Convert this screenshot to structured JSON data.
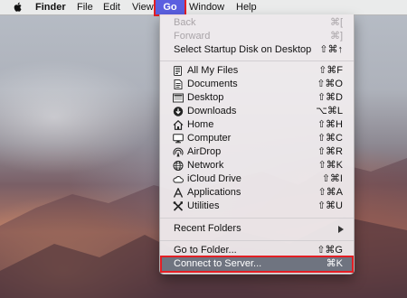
{
  "menubar": {
    "apple": "apple-icon",
    "items": [
      "Finder",
      "File",
      "Edit",
      "View",
      "Go",
      "Window",
      "Help"
    ]
  },
  "go_menu": {
    "top": [
      {
        "label": "Back",
        "shortcut": "⌘[",
        "enabled": false
      },
      {
        "label": "Forward",
        "shortcut": "⌘]",
        "enabled": false
      },
      {
        "label": "Select Startup Disk on Desktop",
        "shortcut": "⇧⌘↑",
        "enabled": true
      }
    ],
    "places": [
      {
        "label": "All My Files",
        "shortcut": "⇧⌘F",
        "icon": "all-my-files-icon"
      },
      {
        "label": "Documents",
        "shortcut": "⇧⌘O",
        "icon": "documents-icon"
      },
      {
        "label": "Desktop",
        "shortcut": "⇧⌘D",
        "icon": "desktop-icon"
      },
      {
        "label": "Downloads",
        "shortcut": "⌥⌘L",
        "icon": "downloads-icon"
      },
      {
        "label": "Home",
        "shortcut": "⇧⌘H",
        "icon": "home-icon"
      },
      {
        "label": "Computer",
        "shortcut": "⇧⌘C",
        "icon": "computer-icon"
      },
      {
        "label": "AirDrop",
        "shortcut": "⇧⌘R",
        "icon": "airdrop-icon"
      },
      {
        "label": "Network",
        "shortcut": "⇧⌘K",
        "icon": "network-icon"
      },
      {
        "label": "iCloud Drive",
        "shortcut": "⇧⌘I",
        "icon": "icloud-drive-icon"
      },
      {
        "label": "Applications",
        "shortcut": "⇧⌘A",
        "icon": "applications-icon"
      },
      {
        "label": "Utilities",
        "shortcut": "⇧⌘U",
        "icon": "utilities-icon"
      }
    ],
    "recent_folders": {
      "label": "Recent Folders"
    },
    "go_to_folder": {
      "label": "Go to Folder...",
      "shortcut": "⇧⌘G"
    },
    "connect_to_server": {
      "label": "Connect to Server...",
      "shortcut": "⌘K",
      "highlighted": true
    }
  },
  "colors": {
    "highlight_outline": "#e31e24",
    "menu_title_active": "#5b5fe0",
    "selected_row": "#6f7480"
  }
}
